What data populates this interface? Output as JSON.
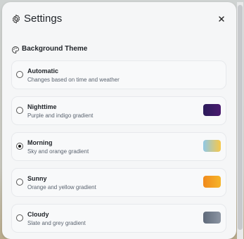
{
  "header": {
    "title": "Settings",
    "settings_icon": "gear-icon",
    "close_icon": "close-icon"
  },
  "section": {
    "title": "Background Theme",
    "icon": "palette-icon"
  },
  "options": [
    {
      "name": "Automatic",
      "description": "Changes based on time and weather",
      "selected": false,
      "swatch": null
    },
    {
      "name": "Nighttime",
      "description": "Purple and indigo gradient",
      "selected": false,
      "swatch": [
        "#2b1b5a",
        "#4a1b6f"
      ]
    },
    {
      "name": "Morning",
      "description": "Sky and orange gradient",
      "selected": true,
      "swatch": [
        "#8fc8e6",
        "#f7c84a"
      ]
    },
    {
      "name": "Sunny",
      "description": "Orange and yellow gradient",
      "selected": false,
      "swatch": [
        "#f08a1c",
        "#f6b52a"
      ]
    },
    {
      "name": "Cloudy",
      "description": "Slate and grey gradient",
      "selected": false,
      "swatch": [
        "#5f6a7a",
        "#8c95a3"
      ]
    }
  ]
}
